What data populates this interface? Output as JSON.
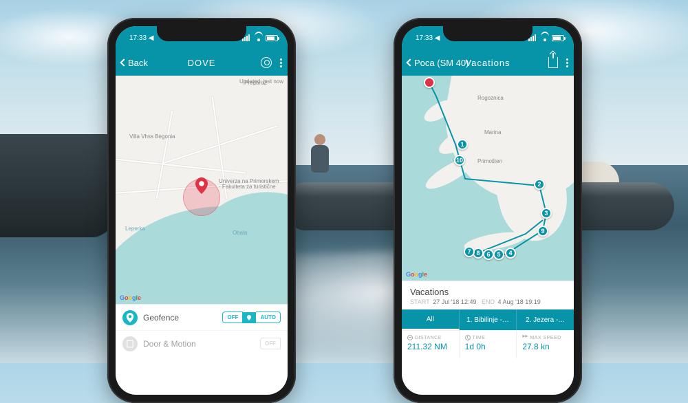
{
  "status": {
    "time": "17:33 ◀"
  },
  "phone1": {
    "nav": {
      "back": "Back",
      "title": "DOVE"
    },
    "map": {
      "updated": "Updated: just now",
      "attrib": "Google",
      "labels": {
        "predaro2": "Preḏoro2",
        "villa": "Villa Vhss Begonia",
        "univ": "Univerza na Primorskem - Fakulteta za turistične",
        "leperka": "Leperka",
        "obala": "Obala"
      }
    },
    "rows": {
      "geofence": {
        "label": "Geofence",
        "off": "OFF",
        "auto": "AUTO"
      },
      "door": {
        "label": "Door & Motion",
        "off": "OFF"
      }
    }
  },
  "phone2": {
    "nav": {
      "back": "Poca (SM 40)",
      "title": "Vacations"
    },
    "map": {
      "attrib": "Google",
      "labels": {
        "rogoznica": "Rogoznica",
        "marina": "Marina",
        "primosten": "Primošten"
      }
    },
    "trip": {
      "title": "Vacations",
      "start_lbl": "START",
      "start": "27 Jul '18 12:49",
      "end_lbl": "END",
      "end": "4 Aug '18 19:19"
    },
    "tabs": {
      "all": "All",
      "t1": "1. Bibilinje -…",
      "t2": "2. Jezera -…"
    },
    "stats": {
      "distance_lbl": "DISTANCE",
      "distance": "211.32 NM",
      "time_lbl": "TIME",
      "time": "1d 0h",
      "speed_lbl": "MAX SPEED",
      "speed": "27.8 kn"
    },
    "waypoints": [
      "1",
      "2",
      "3",
      "4",
      "5",
      "6",
      "7",
      "8",
      "9",
      "10"
    ]
  }
}
